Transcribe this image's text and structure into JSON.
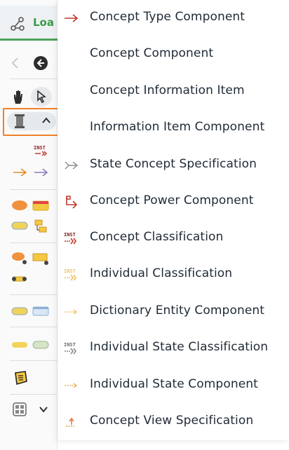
{
  "toolbar": {
    "tab_label": "Loa",
    "back_label": "‹",
    "colors": {
      "accent": "#3a9a4a",
      "highlight": "#f0812b"
    }
  },
  "menu": {
    "items": [
      {
        "label": "Concept Type Component",
        "icon": "red-arrow-icon"
      },
      {
        "label": "Concept Component",
        "icon": ""
      },
      {
        "label": "Concept Information Item",
        "icon": ""
      },
      {
        "label": "Information Item Component",
        "icon": ""
      },
      {
        "label": "State Concept Specification",
        "icon": "state-arrow-icon"
      },
      {
        "label": "Concept Power Component",
        "icon": "power-arrow-icon"
      },
      {
        "label": "Concept Classification",
        "icon": "inst-red-icon"
      },
      {
        "label": "Individual Classification",
        "icon": "inst-yellow-icon"
      },
      {
        "label": "Dictionary Entity Component",
        "icon": "dotted-arrow-icon"
      },
      {
        "label": "Individual State Classification",
        "icon": "inst-gray-icon"
      },
      {
        "label": "Individual State Component",
        "icon": "dotted-arrow-orange-icon"
      },
      {
        "label": "Concept View Specification",
        "icon": "view-arrow-icon"
      }
    ]
  }
}
